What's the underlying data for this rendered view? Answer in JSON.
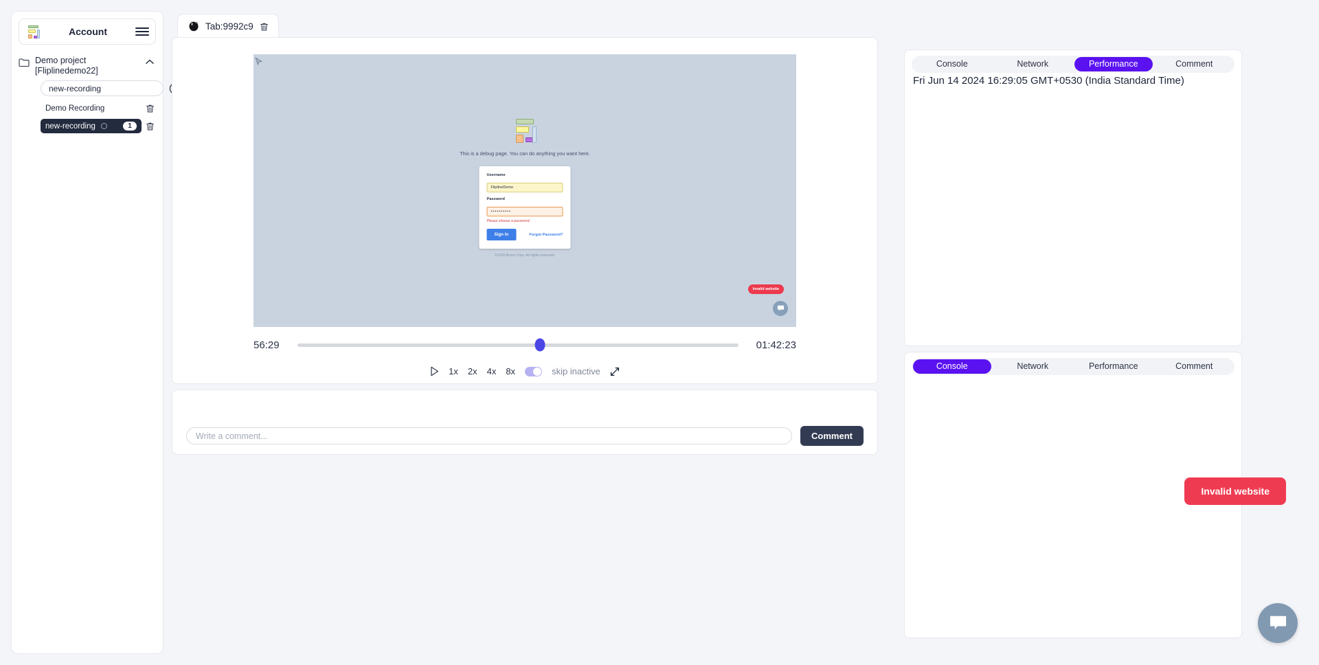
{
  "sidebar": {
    "logo_icon": "blocks-logo-icon",
    "account_label": "Account",
    "menu_icon": "hamburger-menu-icon",
    "project": {
      "folder_icon": "folder-icon",
      "name": "Demo project [Fliplinedemo22]",
      "collapse_icon": "chevron-up-icon"
    },
    "new_recording_value": "new-recording",
    "new_recording_placeholder": "new-recording",
    "record_icon": "record-stop-icon",
    "recordings": [
      {
        "label": "Demo Recording",
        "active": false,
        "count": "",
        "delete_icon": "trash-icon"
      },
      {
        "label": "new-recording",
        "active": true,
        "count": "1",
        "delete_icon": "trash-icon"
      }
    ]
  },
  "tab": {
    "browser_icon": "firefox-icon",
    "label": "Tab:9992c9",
    "close_icon": "trash-icon"
  },
  "player": {
    "cursor_icon": "mouse-cursor-icon",
    "page": {
      "logo_icon": "blocks-logo-icon",
      "debug_text": "This is a debug page. You can do anything you want here.",
      "username_label": "Username",
      "username_value": "FliplineDemo",
      "password_label": "Password",
      "password_value": "••••••••••",
      "error_text": "Please choose a password.",
      "signin_label": "Sign In",
      "forgot_label": "Forgot Password?",
      "copyright": "©2020 Acme Corp. All rights reserved.",
      "badge_label": "Invalid website",
      "chat_icon": "chat-bubble-icon"
    },
    "current_time": "56:29",
    "total_time": "01:42:23",
    "progress_percent": 55,
    "play_icon": "play-icon",
    "speeds": [
      "1x",
      "2x",
      "4x",
      "8x"
    ],
    "skip_inactive_label": "skip inactive",
    "skip_inactive_on": true,
    "fullscreen_icon": "expand-icon"
  },
  "comment": {
    "placeholder": "Write a comment...",
    "value": "",
    "button_label": "Comment"
  },
  "right_panels": [
    {
      "tabs": [
        "Console",
        "Network",
        "Performance",
        "Comment"
      ],
      "active": "Performance",
      "timestamp": "Fri Jun 14 2024 16:29:05 GMT+0530 (India Standard Time)"
    },
    {
      "tabs": [
        "Console",
        "Network",
        "Performance",
        "Comment"
      ],
      "active": "Console",
      "timestamp": ""
    }
  ],
  "floating": {
    "invalid_label": "Invalid website",
    "chat_icon": "chat-bubble-icon"
  },
  "colors": {
    "accent_purple": "#5a12f0",
    "seek_purple": "#4b46e5",
    "danger_red": "#ef3b52",
    "dark": "#232b3e",
    "screen_bg": "#c9d3e0"
  }
}
